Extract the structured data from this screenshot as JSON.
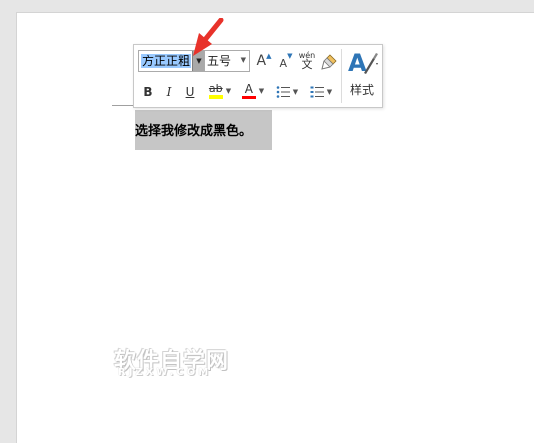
{
  "document": {
    "selected_text": "选择我修改成黑色。"
  },
  "mini_toolbar": {
    "font_name": "方正正粗",
    "font_size": "五号",
    "grow_font_label": "A",
    "shrink_font_label": "A",
    "phonetic_guide_label": "wén",
    "phonetic_guide_char": "文",
    "bold_label": "B",
    "italic_label": "I",
    "underline_label": "U",
    "highlight_label": "ab",
    "font_color_label": "A",
    "styles_label": "样式",
    "colors": {
      "highlight": "#ffff00",
      "font_color": "#ff0000",
      "styles_accent": "#2e75b6"
    }
  },
  "watermark": {
    "main": "软件自学网",
    "sub": "RJZXW.COM"
  }
}
